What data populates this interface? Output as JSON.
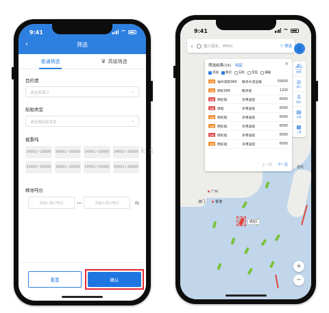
{
  "left_phone": {
    "time": "9:41",
    "title": "筛选",
    "tabs": [
      {
        "label": "普通筛选",
        "active": true
      },
      {
        "label": "高级筛选",
        "active": false
      }
    ],
    "destination": {
      "label": "目的港",
      "placeholder": "请选择港口"
    },
    "ship_type": {
      "label": "船舶类型",
      "placeholder": "请选择船舶类型"
    },
    "dwt": {
      "label": "载重吨",
      "chips": [
        "14001~20000",
        "14001~20000",
        "14001~20000",
        "14001~20000",
        "14001~20000",
        "14001~20000",
        "14001~20000",
        "14001~20000"
      ]
    },
    "position": {
      "label": "精准吨位",
      "min_placeholder": "请输入最小吨位",
      "max_placeholder": "请输入最大吨位",
      "unit": "吨"
    },
    "reset_label": "重置",
    "confirm_label": "确认",
    "accent_color": "#2d7fe0",
    "highlight_color": "#e8262e"
  },
  "right_phone": {
    "time": "9:41",
    "search": {
      "placeholder": "输入船名、MMSI",
      "filter_label": "筛选"
    },
    "tools": [
      {
        "icon": "ship-icon",
        "glyph": "⛴",
        "label": "船舶"
      },
      {
        "icon": "globe-icon",
        "glyph": "◎",
        "label": "港口"
      },
      {
        "icon": "fleet-icon",
        "glyph": "⚓",
        "label": "船队"
      },
      {
        "icon": "record-icon",
        "glyph": "▤",
        "label": "记录"
      },
      {
        "icon": "tools-icon",
        "glyph": "▦",
        "label": "工具"
      }
    ],
    "results": {
      "title": "筛选结果(16)",
      "collapse_label": "收起",
      "checks": [
        {
          "label": "货船",
          "on": true
        },
        {
          "label": "散货",
          "on": true
        },
        {
          "label": "石机",
          "on": false
        },
        {
          "label": "空船",
          "on": false
        },
        {
          "label": "满载",
          "on": false
        }
      ],
      "rows": [
        {
          "badge": "空载",
          "name": "福州调度968",
          "type": "散货水泥运输",
          "value": "50600"
        },
        {
          "badge": "空载",
          "name": "携蛇968",
          "type": "散货船",
          "value": "1200"
        },
        {
          "badge": "空载",
          "name": "携蛇船",
          "type": "多用途船",
          "value": "6000"
        },
        {
          "badge": "空载",
          "name": "携船",
          "type": "多用途船",
          "value": "6000"
        },
        {
          "badge": "空载",
          "name": "携蛇船",
          "type": "多用途船",
          "value": "6000"
        },
        {
          "badge": "空载",
          "name": "携蛇船",
          "type": "多用途船",
          "value": "6000"
        },
        {
          "badge": "空载",
          "name": "携蛇船",
          "type": "多用途船",
          "value": "6000"
        },
        {
          "badge": "空载",
          "name": "携蛇船",
          "type": "多用途船",
          "value": "6000"
        }
      ],
      "prev_label": "上一页",
      "next_label": "下一页"
    },
    "places": {
      "guangzhou": "广州",
      "macau": "澳门",
      "hongkong": "香港",
      "taibei": "台北",
      "shantou": "汕头"
    },
    "ship_label": "携船1",
    "zoom_in": "+",
    "zoom_out": "−"
  },
  "watermark": "k s"
}
